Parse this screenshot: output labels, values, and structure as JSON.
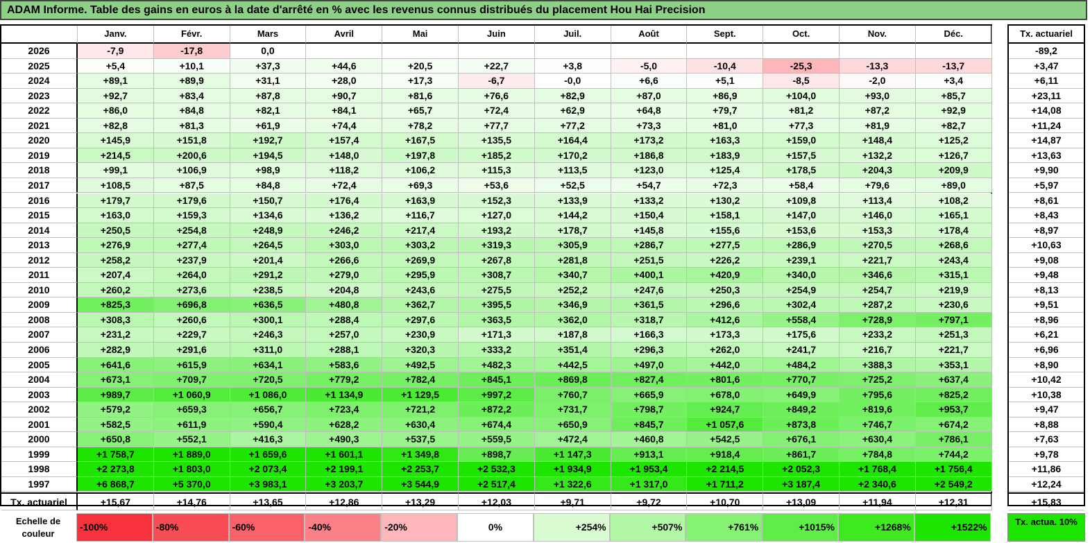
{
  "title": "ADAM Informe. Table des gains en euros à la date d'arrêté en % avec les revenus connus distribués du placement Hou Hai Precision",
  "months": [
    "Janv.",
    "Févr.",
    "Mars",
    "Avril",
    "Mai",
    "Juin",
    "Juil.",
    "Août",
    "Sept.",
    "Oct.",
    "Nov.",
    "Déc."
  ],
  "side_header": "Tx. actuariel",
  "footer_label": "Tx. actuariel",
  "rows": [
    {
      "year": "2026",
      "cells": [
        "-7,9",
        "-17,8",
        "0,0",
        "",
        "",
        "",
        "",
        "",
        "",
        "",
        "",
        ""
      ],
      "rate": "-89,2"
    },
    {
      "year": "2025",
      "cells": [
        "+5,4",
        "+10,1",
        "+37,3",
        "+44,6",
        "+20,5",
        "+22,7",
        "+3,8",
        "-5,0",
        "-10,4",
        "-25,3",
        "-13,3",
        "-13,7"
      ],
      "rate": "+3,47"
    },
    {
      "year": "2024",
      "cells": [
        "+89,1",
        "+89,9",
        "+31,1",
        "+28,0",
        "+17,3",
        "-6,7",
        "-0,0",
        "+6,6",
        "+5,1",
        "-8,5",
        "-2,0",
        "+3,4"
      ],
      "rate": "+6,11"
    },
    {
      "year": "2023",
      "cells": [
        "+92,7",
        "+83,4",
        "+87,8",
        "+90,7",
        "+81,6",
        "+76,6",
        "+82,9",
        "+87,0",
        "+86,9",
        "+104,0",
        "+93,0",
        "+85,7"
      ],
      "rate": "+23,11"
    },
    {
      "year": "2022",
      "cells": [
        "+86,0",
        "+84,8",
        "+82,1",
        "+84,1",
        "+65,7",
        "+72,4",
        "+62,9",
        "+64,8",
        "+79,7",
        "+81,2",
        "+87,2",
        "+92,9"
      ],
      "rate": "+14,08"
    },
    {
      "year": "2021",
      "cells": [
        "+82,8",
        "+81,3",
        "+61,9",
        "+74,4",
        "+78,2",
        "+77,7",
        "+77,2",
        "+73,3",
        "+81,0",
        "+77,3",
        "+81,9",
        "+82,7"
      ],
      "rate": "+11,24"
    },
    {
      "year": "2020",
      "cells": [
        "+145,9",
        "+151,8",
        "+192,7",
        "+157,4",
        "+167,5",
        "+135,5",
        "+164,4",
        "+173,2",
        "+163,3",
        "+159,0",
        "+148,4",
        "+125,2"
      ],
      "rate": "+14,87"
    },
    {
      "year": "2019",
      "cells": [
        "+214,5",
        "+200,6",
        "+194,5",
        "+148,0",
        "+197,8",
        "+185,2",
        "+170,2",
        "+186,8",
        "+183,9",
        "+157,5",
        "+132,2",
        "+126,7"
      ],
      "rate": "+13,63"
    },
    {
      "year": "2018",
      "cells": [
        "+99,1",
        "+106,9",
        "+98,9",
        "+118,2",
        "+106,2",
        "+115,3",
        "+113,5",
        "+123,0",
        "+125,4",
        "+178,5",
        "+204,3",
        "+209,9"
      ],
      "rate": "+9,90"
    },
    {
      "year": "2017",
      "cells": [
        "+108,5",
        "+87,5",
        "+84,8",
        "+72,4",
        "+69,3",
        "+53,6",
        "+52,5",
        "+54,7",
        "+72,3",
        "+58,4",
        "+79,6",
        "+89,0"
      ],
      "rate": "+5,97"
    },
    {
      "year": "2016",
      "cells": [
        "+179,7",
        "+179,6",
        "+150,7",
        "+176,4",
        "+163,9",
        "+152,3",
        "+133,9",
        "+133,2",
        "+130,2",
        "+109,8",
        "+113,4",
        "+108,2"
      ],
      "rate": "+8,61"
    },
    {
      "year": "2015",
      "cells": [
        "+163,0",
        "+159,3",
        "+134,6",
        "+136,2",
        "+116,7",
        "+127,0",
        "+144,2",
        "+150,4",
        "+158,1",
        "+147,0",
        "+146,0",
        "+165,1"
      ],
      "rate": "+8,43"
    },
    {
      "year": "2014",
      "cells": [
        "+250,5",
        "+254,8",
        "+248,9",
        "+246,2",
        "+217,4",
        "+193,2",
        "+178,7",
        "+145,8",
        "+155,6",
        "+153,6",
        "+153,3",
        "+178,4"
      ],
      "rate": "+8,97"
    },
    {
      "year": "2013",
      "cells": [
        "+276,9",
        "+277,4",
        "+264,5",
        "+303,0",
        "+303,2",
        "+319,3",
        "+305,9",
        "+286,7",
        "+277,5",
        "+286,9",
        "+270,5",
        "+268,6"
      ],
      "rate": "+10,63"
    },
    {
      "year": "2012",
      "cells": [
        "+258,2",
        "+237,9",
        "+201,4",
        "+266,6",
        "+269,9",
        "+267,8",
        "+281,8",
        "+251,5",
        "+226,2",
        "+239,1",
        "+221,7",
        "+243,4"
      ],
      "rate": "+9,08"
    },
    {
      "year": "2011",
      "cells": [
        "+207,4",
        "+264,0",
        "+291,2",
        "+279,0",
        "+295,9",
        "+308,7",
        "+340,7",
        "+400,1",
        "+420,9",
        "+340,0",
        "+346,6",
        "+315,1"
      ],
      "rate": "+9,48"
    },
    {
      "year": "2010",
      "cells": [
        "+260,2",
        "+273,6",
        "+238,5",
        "+204,8",
        "+243,6",
        "+275,5",
        "+252,2",
        "+247,6",
        "+250,3",
        "+254,9",
        "+254,7",
        "+219,9"
      ],
      "rate": "+8,13"
    },
    {
      "year": "2009",
      "cells": [
        "+825,3",
        "+696,8",
        "+636,5",
        "+480,8",
        "+362,7",
        "+395,5",
        "+346,9",
        "+361,5",
        "+296,6",
        "+302,4",
        "+287,2",
        "+230,6"
      ],
      "rate": "+9,51"
    },
    {
      "year": "2008",
      "cells": [
        "+308,3",
        "+260,6",
        "+300,1",
        "+288,4",
        "+297,6",
        "+363,5",
        "+362,0",
        "+318,7",
        "+412,6",
        "+558,4",
        "+728,9",
        "+797,1"
      ],
      "rate": "+8,96"
    },
    {
      "year": "2007",
      "cells": [
        "+231,2",
        "+229,7",
        "+246,3",
        "+257,0",
        "+230,9",
        "+171,3",
        "+187,8",
        "+166,3",
        "+173,3",
        "+175,6",
        "+233,2",
        "+251,3"
      ],
      "rate": "+6,21"
    },
    {
      "year": "2006",
      "cells": [
        "+282,9",
        "+291,6",
        "+311,0",
        "+288,1",
        "+320,3",
        "+333,2",
        "+351,4",
        "+296,3",
        "+262,0",
        "+241,7",
        "+216,7",
        "+221,7"
      ],
      "rate": "+6,96"
    },
    {
      "year": "2005",
      "cells": [
        "+641,6",
        "+615,9",
        "+634,1",
        "+583,6",
        "+492,5",
        "+482,3",
        "+442,5",
        "+497,0",
        "+442,0",
        "+484,2",
        "+388,3",
        "+353,1"
      ],
      "rate": "+8,90"
    },
    {
      "year": "2004",
      "cells": [
        "+673,1",
        "+709,7",
        "+720,5",
        "+779,2",
        "+782,4",
        "+845,1",
        "+869,8",
        "+827,4",
        "+801,6",
        "+770,7",
        "+725,2",
        "+637,4"
      ],
      "rate": "+10,42"
    },
    {
      "year": "2003",
      "cells": [
        "+989,7",
        "+1 060,9",
        "+1 086,0",
        "+1 134,9",
        "+1 129,5",
        "+997,2",
        "+760,7",
        "+665,9",
        "+678,0",
        "+649,9",
        "+795,6",
        "+825,2"
      ],
      "rate": "+10,38"
    },
    {
      "year": "2002",
      "cells": [
        "+579,2",
        "+659,3",
        "+656,7",
        "+723,4",
        "+721,2",
        "+872,2",
        "+731,7",
        "+798,7",
        "+924,7",
        "+849,2",
        "+819,6",
        "+953,7"
      ],
      "rate": "+9,47"
    },
    {
      "year": "2001",
      "cells": [
        "+582,5",
        "+611,9",
        "+590,4",
        "+628,2",
        "+630,4",
        "+674,4",
        "+650,9",
        "+845,7",
        "+1 057,6",
        "+873,8",
        "+746,7",
        "+674,2"
      ],
      "rate": "+8,88"
    },
    {
      "year": "2000",
      "cells": [
        "+650,8",
        "+552,1",
        "+416,3",
        "+490,3",
        "+537,5",
        "+559,5",
        "+472,4",
        "+460,8",
        "+542,5",
        "+676,1",
        "+630,4",
        "+786,1"
      ],
      "rate": "+7,63"
    },
    {
      "year": "1999",
      "cells": [
        "+1 758,7",
        "+1 889,0",
        "+1 659,6",
        "+1 601,1",
        "+1 349,8",
        "+898,7",
        "+1 147,3",
        "+913,1",
        "+918,4",
        "+861,7",
        "+784,8",
        "+744,2"
      ],
      "rate": "+9,78"
    },
    {
      "year": "1998",
      "cells": [
        "+2 273,8",
        "+1 803,0",
        "+2 073,4",
        "+2 199,1",
        "+2 253,7",
        "+2 532,3",
        "+1 934,9",
        "+1 953,4",
        "+2 214,5",
        "+2 052,3",
        "+1 768,4",
        "+1 756,4"
      ],
      "rate": "+11,86"
    },
    {
      "year": "1997",
      "cells": [
        "+6 868,7",
        "+5 370,0",
        "+3 983,1",
        "+3 203,7",
        "+3 544,9",
        "+2 517,4",
        "+1 322,6",
        "+1 317,0",
        "+1 711,2",
        "+3 187,4",
        "+2 340,6",
        "+2 549,2"
      ],
      "rate": "+12,24"
    }
  ],
  "footer_cells": [
    "+15,67",
    "+14,76",
    "+13,65",
    "+12,86",
    "+13,29",
    "+12,03",
    "+9,71",
    "+9,72",
    "+10,70",
    "+13,09",
    "+11,94",
    "+12,31"
  ],
  "footer_rate": "+15,83",
  "scale_label": "Echelle de couleur",
  "scale": [
    {
      "label": "-100%",
      "color": "#f8323c"
    },
    {
      "label": "-80%",
      "color": "#f94d55"
    },
    {
      "label": "-60%",
      "color": "#fa6168"
    },
    {
      "label": "-40%",
      "color": "#fb8087"
    },
    {
      "label": "-20%",
      "color": "#fdb7ba"
    },
    {
      "label": "0%",
      "color": "#ffffff"
    },
    {
      "label": "+254%",
      "color": "#d8fbd2"
    },
    {
      "label": "+507%",
      "color": "#b1f7a6"
    },
    {
      "label": "+761%",
      "color": "#86f274"
    },
    {
      "label": "+1015%",
      "color": "#5eee47"
    },
    {
      "label": "+1268%",
      "color": "#3dea20"
    },
    {
      "label": "+1522%",
      "color": "#1ee500"
    }
  ],
  "scale_side_label": "Tx. actua. 10%",
  "scale_side_color": "#1ee500"
}
